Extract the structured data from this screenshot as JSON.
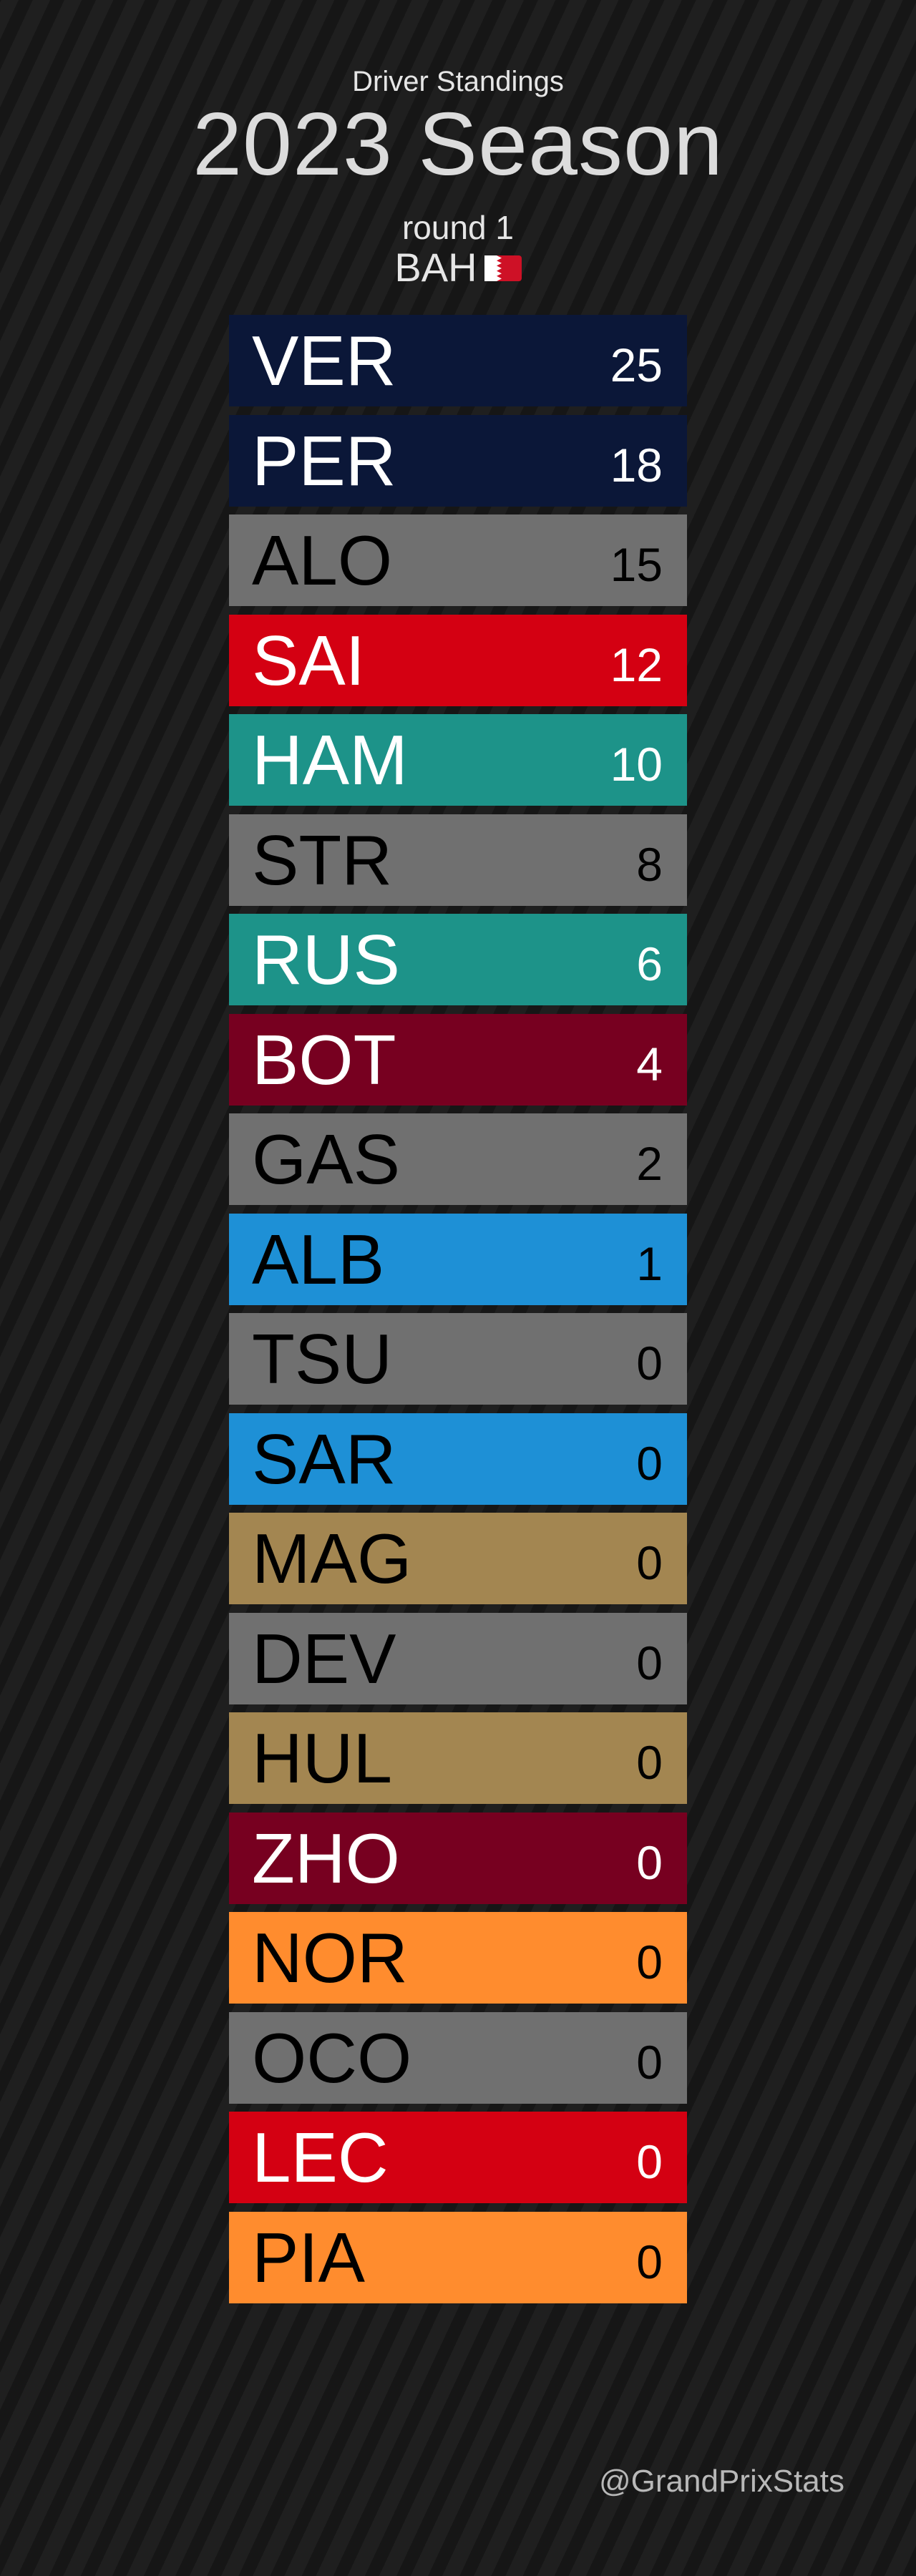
{
  "header": {
    "subtitle": "Driver Standings",
    "title": "2023 Season"
  },
  "round_label": "round 1",
  "race_code": "BAH",
  "flag": {
    "icon": "bahrain-flag-icon",
    "colors": [
      "#ffffff",
      "#ce1126"
    ]
  },
  "credit": "@GrandPrixStats",
  "chart_data": {
    "type": "table",
    "columns": [
      "driver",
      "points"
    ],
    "rows": [
      {
        "driver": "VER",
        "points": "25",
        "color": "#0b1738",
        "text_color": "#ffffff"
      },
      {
        "driver": "PER",
        "points": "18",
        "color": "#0b1738",
        "text_color": "#ffffff"
      },
      {
        "driver": "ALO",
        "points": "15",
        "color": "#707070",
        "text_color": "#000000"
      },
      {
        "driver": "SAI",
        "points": "12",
        "color": "#d40012",
        "text_color": "#ffffff"
      },
      {
        "driver": "HAM",
        "points": "10",
        "color": "#1d9389",
        "text_color": "#ffffff"
      },
      {
        "driver": "STR",
        "points": "8",
        "color": "#707070",
        "text_color": "#000000"
      },
      {
        "driver": "RUS",
        "points": "6",
        "color": "#1d9389",
        "text_color": "#ffffff"
      },
      {
        "driver": "BOT",
        "points": "4",
        "color": "#770020",
        "text_color": "#ffffff"
      },
      {
        "driver": "GAS",
        "points": "2",
        "color": "#707070",
        "text_color": "#000000"
      },
      {
        "driver": "ALB",
        "points": "1",
        "color": "#1e90d6",
        "text_color": "#000000"
      },
      {
        "driver": "TSU",
        "points": "0",
        "color": "#707070",
        "text_color": "#000000"
      },
      {
        "driver": "SAR",
        "points": "0",
        "color": "#1e90d6",
        "text_color": "#000000"
      },
      {
        "driver": "MAG",
        "points": "0",
        "color": "#a38651",
        "text_color": "#000000"
      },
      {
        "driver": "DEV",
        "points": "0",
        "color": "#707070",
        "text_color": "#000000"
      },
      {
        "driver": "HUL",
        "points": "0",
        "color": "#a38651",
        "text_color": "#000000"
      },
      {
        "driver": "ZHO",
        "points": "0",
        "color": "#770020",
        "text_color": "#ffffff"
      },
      {
        "driver": "NOR",
        "points": "0",
        "color": "#ff8c2e",
        "text_color": "#000000"
      },
      {
        "driver": "OCO",
        "points": "0",
        "color": "#707070",
        "text_color": "#000000"
      },
      {
        "driver": "LEC",
        "points": "0",
        "color": "#d40012",
        "text_color": "#ffffff"
      },
      {
        "driver": "PIA",
        "points": "0",
        "color": "#ff8c2e",
        "text_color": "#000000"
      }
    ]
  }
}
